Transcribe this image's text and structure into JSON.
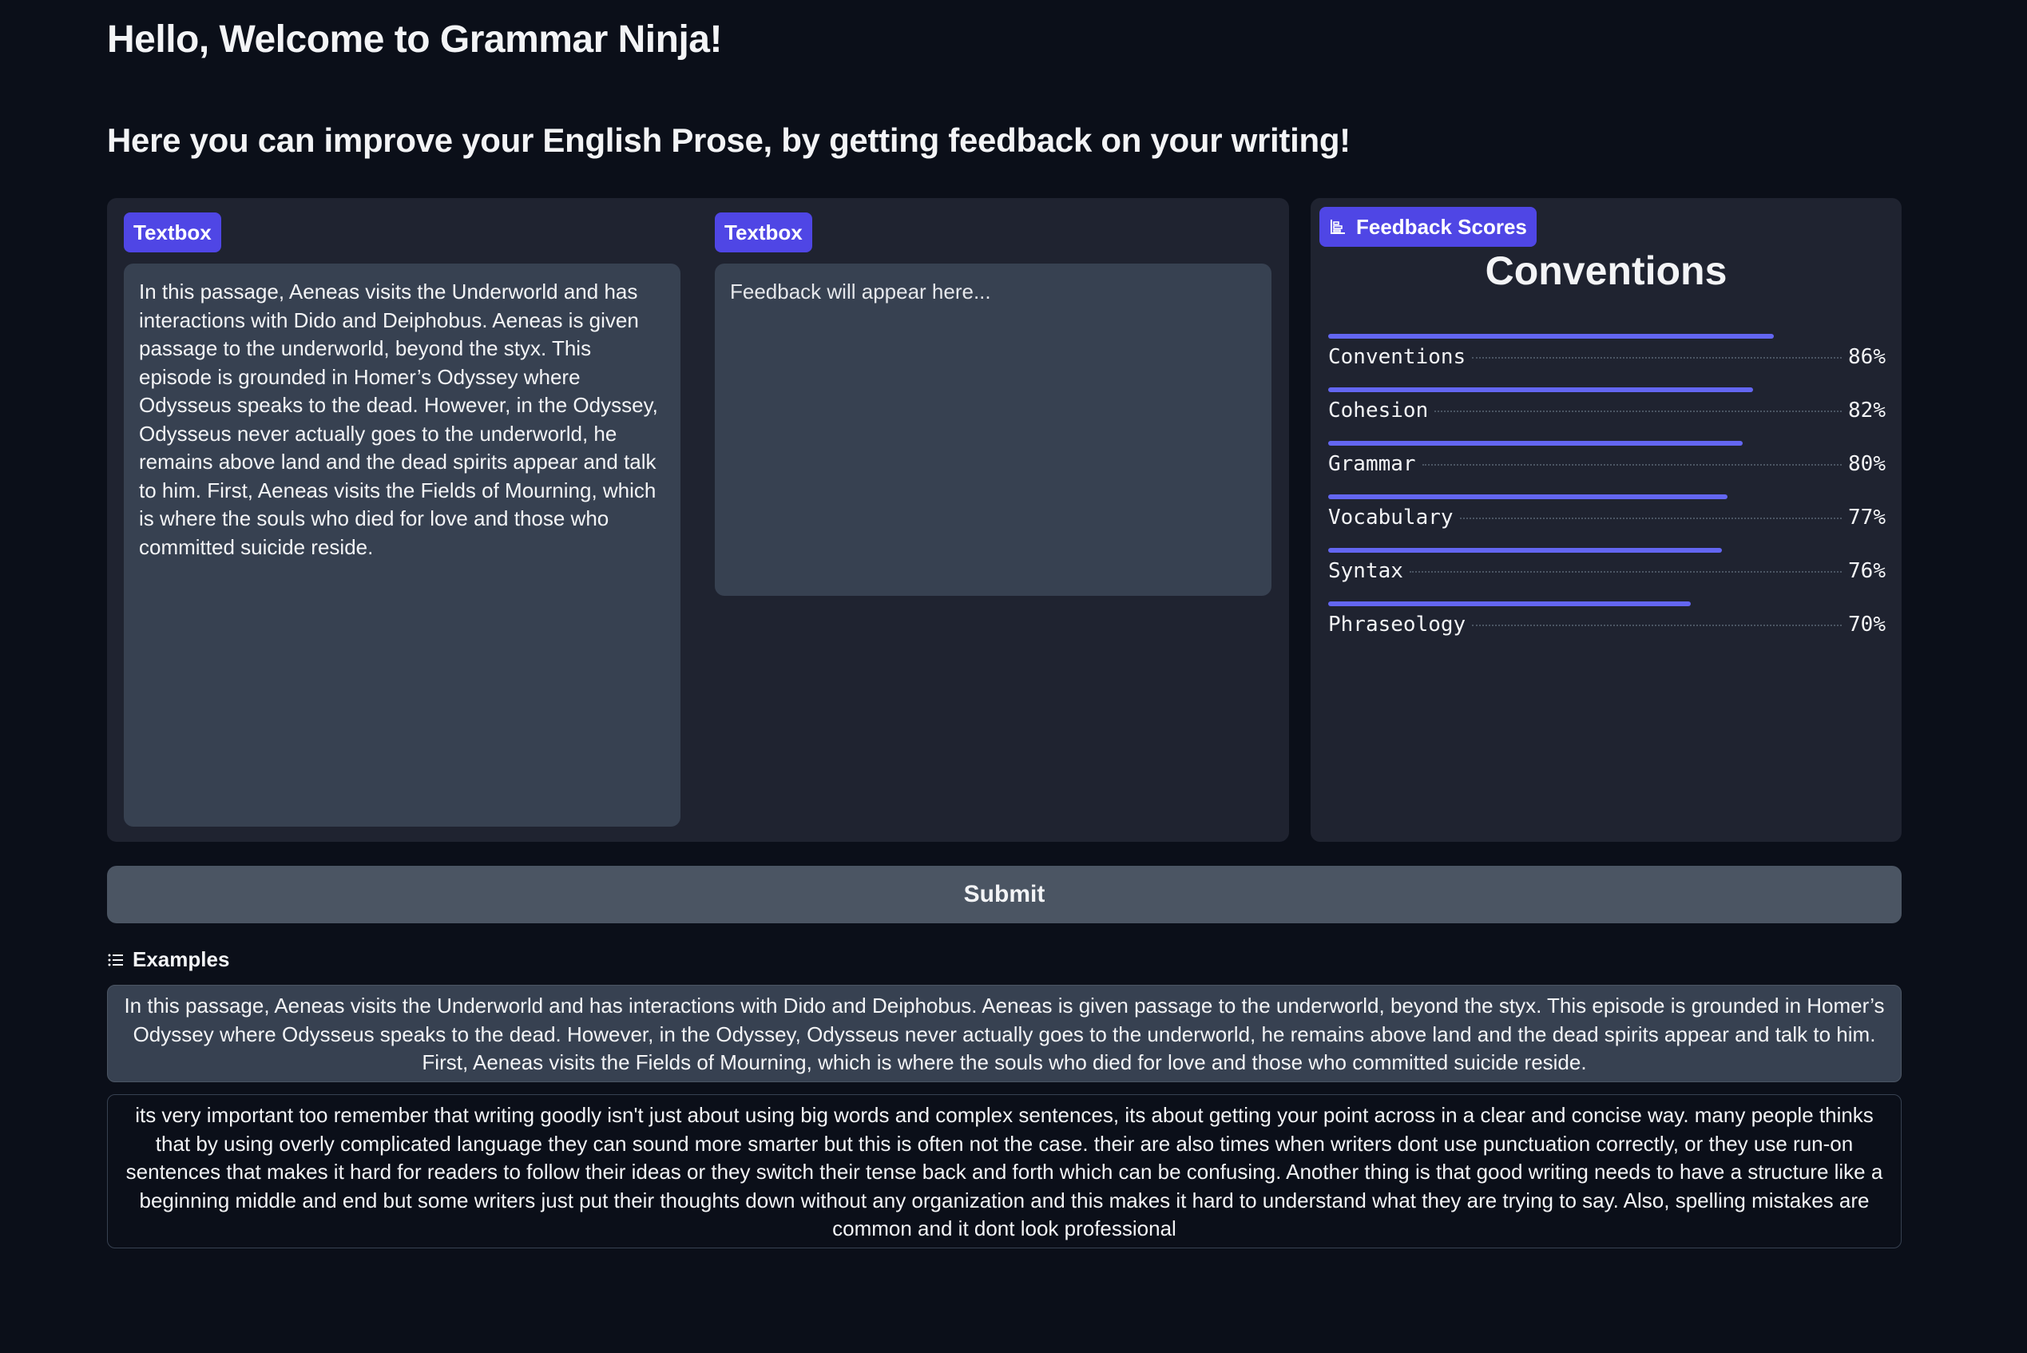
{
  "header": {
    "title": "Hello, Welcome to Grammar Ninja!",
    "subtitle": "Here you can improve your English Prose, by getting feedback on your writing!"
  },
  "input_box": {
    "label": "Textbox",
    "value": "In this passage, Aeneas visits the Underworld and has interactions with Dido and Deiphobus. Aeneas is given passage to the underworld, beyond the styx. This episode is grounded in Homer’s Odyssey where Odysseus speaks to the dead. However, in the Odyssey, Odysseus never actually goes to the underworld, he remains above land and the dead spirits appear and talk to him. First, Aeneas visits the Fields of Mourning, which is where the souls who died for love and those who committed suicide reside."
  },
  "feedback_box": {
    "label": "Textbox",
    "placeholder": "Feedback will appear here..."
  },
  "scores_panel": {
    "label": "Feedback Scores",
    "icon": "bar-chart-icon",
    "heading": "Conventions"
  },
  "chart_data": {
    "type": "bar",
    "title": "Conventions",
    "categories": [
      "Conventions",
      "Cohesion",
      "Grammar",
      "Vocabulary",
      "Syntax",
      "Phraseology"
    ],
    "values": [
      86,
      82,
      80,
      77,
      76,
      70
    ],
    "value_labels": [
      "86%",
      "82%",
      "80%",
      "77%",
      "76%",
      "70%"
    ],
    "ylim": [
      0,
      100
    ],
    "bar_color": "#6366f1"
  },
  "submit_label": "Submit",
  "examples": {
    "heading": "Examples",
    "icon": "list-icon",
    "items": [
      "In this passage, Aeneas visits the Underworld and has interactions with Dido and Deiphobus. Aeneas is given passage to the underworld, beyond the styx. This episode is grounded in Homer’s Odyssey where Odysseus speaks to the dead. However, in the Odyssey, Odysseus never actually goes to the underworld, he remains above land and the dead spirits appear and talk to him. First, Aeneas visits the Fields of Mourning, which is where the souls who died for love and those who committed suicide reside.",
      "its very important too remember that writing goodly isn't just about using big words and complex sentences, its about getting your point across in a clear and concise way. many people thinks that by using overly complicated language they can sound more smarter but this is often not the case. their are also times when writers dont use punctuation correctly, or they use run-on sentences that makes it hard for readers to follow their ideas or they switch their tense back and forth which can be confusing. Another thing is that good writing needs to have a structure like a beginning middle and end but some writers just put their thoughts down without any organization and this makes it hard to understand what they are trying to say. Also, spelling mistakes are common and it dont look professional"
    ]
  },
  "colors": {
    "background": "#0b0f19",
    "panel": "#1f2330",
    "input": "#374151",
    "accent": "#4f46e5",
    "button": "#4b5563"
  }
}
